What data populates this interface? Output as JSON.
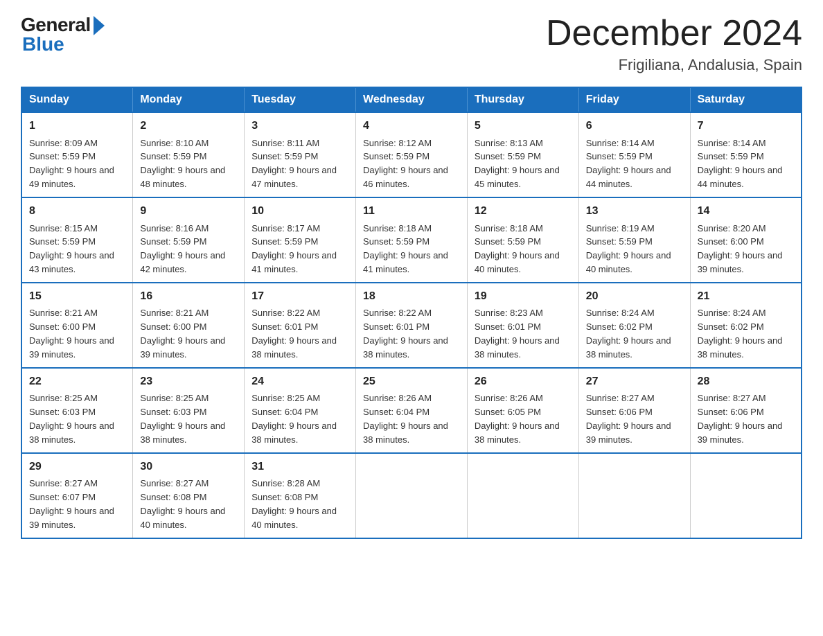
{
  "logo": {
    "general": "General",
    "blue": "Blue"
  },
  "header": {
    "month": "December 2024",
    "location": "Frigiliana, Andalusia, Spain"
  },
  "days_of_week": [
    "Sunday",
    "Monday",
    "Tuesday",
    "Wednesday",
    "Thursday",
    "Friday",
    "Saturday"
  ],
  "weeks": [
    [
      {
        "day": "1",
        "sunrise": "8:09 AM",
        "sunset": "5:59 PM",
        "daylight": "9 hours and 49 minutes."
      },
      {
        "day": "2",
        "sunrise": "8:10 AM",
        "sunset": "5:59 PM",
        "daylight": "9 hours and 48 minutes."
      },
      {
        "day": "3",
        "sunrise": "8:11 AM",
        "sunset": "5:59 PM",
        "daylight": "9 hours and 47 minutes."
      },
      {
        "day": "4",
        "sunrise": "8:12 AM",
        "sunset": "5:59 PM",
        "daylight": "9 hours and 46 minutes."
      },
      {
        "day": "5",
        "sunrise": "8:13 AM",
        "sunset": "5:59 PM",
        "daylight": "9 hours and 45 minutes."
      },
      {
        "day": "6",
        "sunrise": "8:14 AM",
        "sunset": "5:59 PM",
        "daylight": "9 hours and 44 minutes."
      },
      {
        "day": "7",
        "sunrise": "8:14 AM",
        "sunset": "5:59 PM",
        "daylight": "9 hours and 44 minutes."
      }
    ],
    [
      {
        "day": "8",
        "sunrise": "8:15 AM",
        "sunset": "5:59 PM",
        "daylight": "9 hours and 43 minutes."
      },
      {
        "day": "9",
        "sunrise": "8:16 AM",
        "sunset": "5:59 PM",
        "daylight": "9 hours and 42 minutes."
      },
      {
        "day": "10",
        "sunrise": "8:17 AM",
        "sunset": "5:59 PM",
        "daylight": "9 hours and 41 minutes."
      },
      {
        "day": "11",
        "sunrise": "8:18 AM",
        "sunset": "5:59 PM",
        "daylight": "9 hours and 41 minutes."
      },
      {
        "day": "12",
        "sunrise": "8:18 AM",
        "sunset": "5:59 PM",
        "daylight": "9 hours and 40 minutes."
      },
      {
        "day": "13",
        "sunrise": "8:19 AM",
        "sunset": "5:59 PM",
        "daylight": "9 hours and 40 minutes."
      },
      {
        "day": "14",
        "sunrise": "8:20 AM",
        "sunset": "6:00 PM",
        "daylight": "9 hours and 39 minutes."
      }
    ],
    [
      {
        "day": "15",
        "sunrise": "8:21 AM",
        "sunset": "6:00 PM",
        "daylight": "9 hours and 39 minutes."
      },
      {
        "day": "16",
        "sunrise": "8:21 AM",
        "sunset": "6:00 PM",
        "daylight": "9 hours and 39 minutes."
      },
      {
        "day": "17",
        "sunrise": "8:22 AM",
        "sunset": "6:01 PM",
        "daylight": "9 hours and 38 minutes."
      },
      {
        "day": "18",
        "sunrise": "8:22 AM",
        "sunset": "6:01 PM",
        "daylight": "9 hours and 38 minutes."
      },
      {
        "day": "19",
        "sunrise": "8:23 AM",
        "sunset": "6:01 PM",
        "daylight": "9 hours and 38 minutes."
      },
      {
        "day": "20",
        "sunrise": "8:24 AM",
        "sunset": "6:02 PM",
        "daylight": "9 hours and 38 minutes."
      },
      {
        "day": "21",
        "sunrise": "8:24 AM",
        "sunset": "6:02 PM",
        "daylight": "9 hours and 38 minutes."
      }
    ],
    [
      {
        "day": "22",
        "sunrise": "8:25 AM",
        "sunset": "6:03 PM",
        "daylight": "9 hours and 38 minutes."
      },
      {
        "day": "23",
        "sunrise": "8:25 AM",
        "sunset": "6:03 PM",
        "daylight": "9 hours and 38 minutes."
      },
      {
        "day": "24",
        "sunrise": "8:25 AM",
        "sunset": "6:04 PM",
        "daylight": "9 hours and 38 minutes."
      },
      {
        "day": "25",
        "sunrise": "8:26 AM",
        "sunset": "6:04 PM",
        "daylight": "9 hours and 38 minutes."
      },
      {
        "day": "26",
        "sunrise": "8:26 AM",
        "sunset": "6:05 PM",
        "daylight": "9 hours and 38 minutes."
      },
      {
        "day": "27",
        "sunrise": "8:27 AM",
        "sunset": "6:06 PM",
        "daylight": "9 hours and 39 minutes."
      },
      {
        "day": "28",
        "sunrise": "8:27 AM",
        "sunset": "6:06 PM",
        "daylight": "9 hours and 39 minutes."
      }
    ],
    [
      {
        "day": "29",
        "sunrise": "8:27 AM",
        "sunset": "6:07 PM",
        "daylight": "9 hours and 39 minutes."
      },
      {
        "day": "30",
        "sunrise": "8:27 AM",
        "sunset": "6:08 PM",
        "daylight": "9 hours and 40 minutes."
      },
      {
        "day": "31",
        "sunrise": "8:28 AM",
        "sunset": "6:08 PM",
        "daylight": "9 hours and 40 minutes."
      },
      null,
      null,
      null,
      null
    ]
  ]
}
